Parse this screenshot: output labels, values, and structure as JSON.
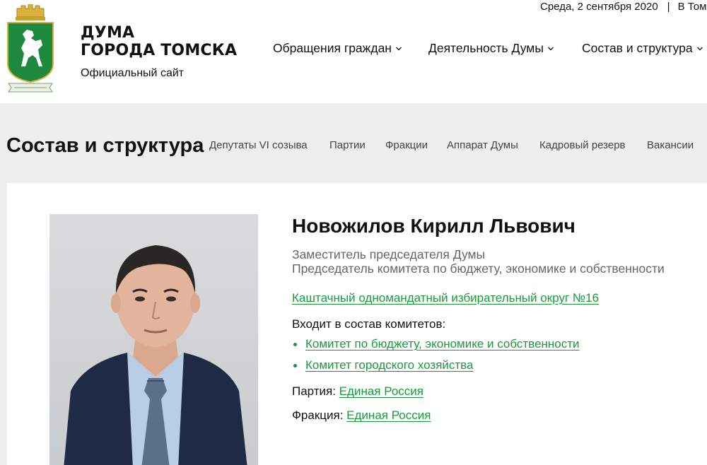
{
  "header": {
    "brand_line1": "ДУМА",
    "brand_line2": "ГОРОДА ТОМСКА",
    "brand_subtitle": "Официальный сайт",
    "date": "Среда, 2 сентября 2020",
    "separator": "|",
    "city_link": "В Том",
    "logo_icon": "tomsk-crest-horse-icon",
    "nav": [
      {
        "label": "Обращения граждан"
      },
      {
        "label": "Деятельность Думы"
      },
      {
        "label": "Состав и структура"
      }
    ]
  },
  "section": {
    "title": "Состав и структура",
    "subnav": [
      {
        "label": "Депутаты VI созыва"
      },
      {
        "label": "Партии"
      },
      {
        "label": "Фракции"
      },
      {
        "label": "Аппарат Думы"
      },
      {
        "label": "Кадровый резерв"
      },
      {
        "label": "Вакансии"
      }
    ]
  },
  "profile": {
    "name": "Новожилов Кирилл Львович",
    "role1": "Заместитель председателя Думы",
    "role2": "Председатель комитета по бюджету, экономике и собственности",
    "district": "Каштачный одномандатный избирательный округ №16",
    "committees_label": "Входит в состав комитетов:",
    "committees": [
      {
        "label": "Комитет по бюджету, экономике и собственности"
      },
      {
        "label": "Комитет городского хозяйства"
      }
    ],
    "party_label": "Партия:",
    "party": "Единая Россия",
    "fraction_label": "Фракция:",
    "fraction": "Единая Россия"
  },
  "colors": {
    "link_green": "#1b9a3c",
    "section_bg": "#eeeeee",
    "crest_green": "#1e8a3e",
    "crest_gold": "#d8b13a"
  }
}
